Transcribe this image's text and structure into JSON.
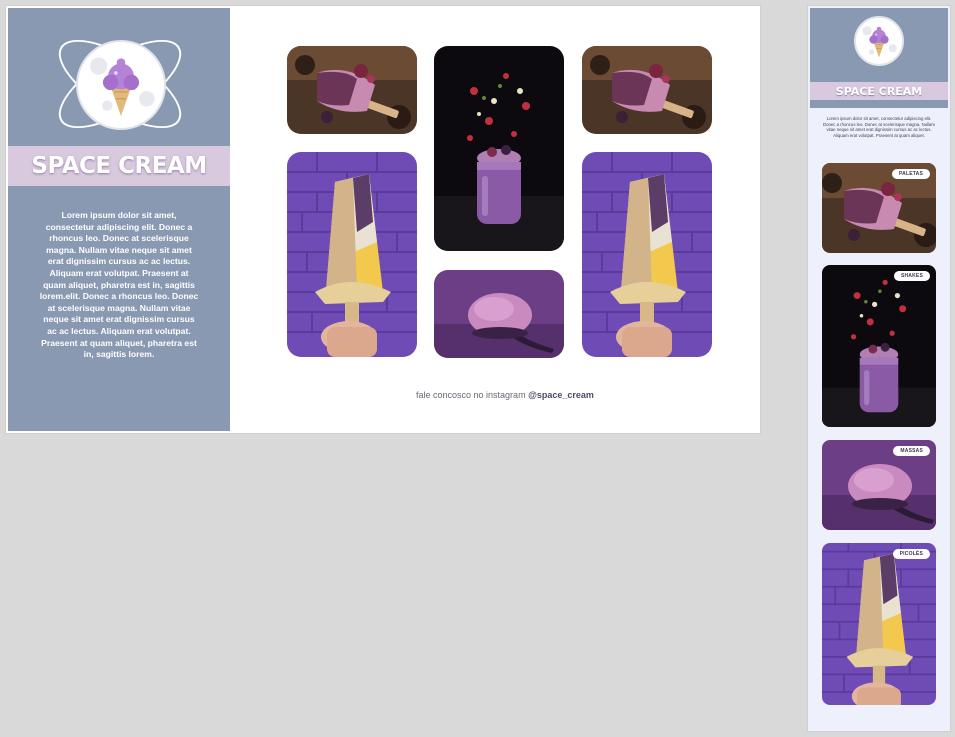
{
  "brand": {
    "name": "SPACE CREAM",
    "colors": {
      "sidebar": "#8a99b2",
      "band": "#d8c9df",
      "accent_purple": "#7b55c7",
      "page_bg": "#d9d9d9"
    }
  },
  "desktop": {
    "sidebar": {
      "logo_icon": "ice-cream-icon",
      "title": "SPACE CREAM",
      "description": "Lorem ipsum dolor sit amet, consectetur adipiscing elit. Donec a rhoncus leo. Donec at scelerisque magna. Nullam vitae neque sit amet erat dignissim cursus ac ac lectus. Aliquam erat volutpat. Praesent at quam aliquet, pharetra est in, sagittis lorem.elit. Donec a rhoncus leo. Donec at scelerisque magna. Nullam vitae neque sit amet erat dignissim cursus ac ac lectus. Aliquam erat volutpat. Praesent at quam aliquet, pharetra est in, sagittis lorem."
    },
    "gallery": [
      {
        "name": "gallery-paleta-berry",
        "kind": "paleta"
      },
      {
        "name": "gallery-shake-jar",
        "kind": "shake"
      },
      {
        "name": "gallery-paleta-berry-2",
        "kind": "paleta"
      },
      {
        "name": "gallery-picole-nuts",
        "kind": "picole"
      },
      {
        "name": "gallery-massa-scoop",
        "kind": "massa"
      },
      {
        "name": "gallery-picole-nuts-2",
        "kind": "picole"
      }
    ],
    "instagram": {
      "prefix": "fale concosco no instagram",
      "handle": "@space_cream"
    }
  },
  "mobile": {
    "title": "SPACE CREAM",
    "description": "Lorem ipsum dolor sit amet, consectetur adipiscing elit. Donec a rhoncus leo. Donec at scelerisque magna. Nullam vitae neque sit amet erat dignissim cursus ac ac lectus. Aliquam erat volutpat. Praesent at quam aliquet.",
    "cards": [
      {
        "label": "PALETAS"
      },
      {
        "label": "SHAKES"
      },
      {
        "label": "MASSAS"
      },
      {
        "label": "PICOLÉS"
      }
    ]
  }
}
